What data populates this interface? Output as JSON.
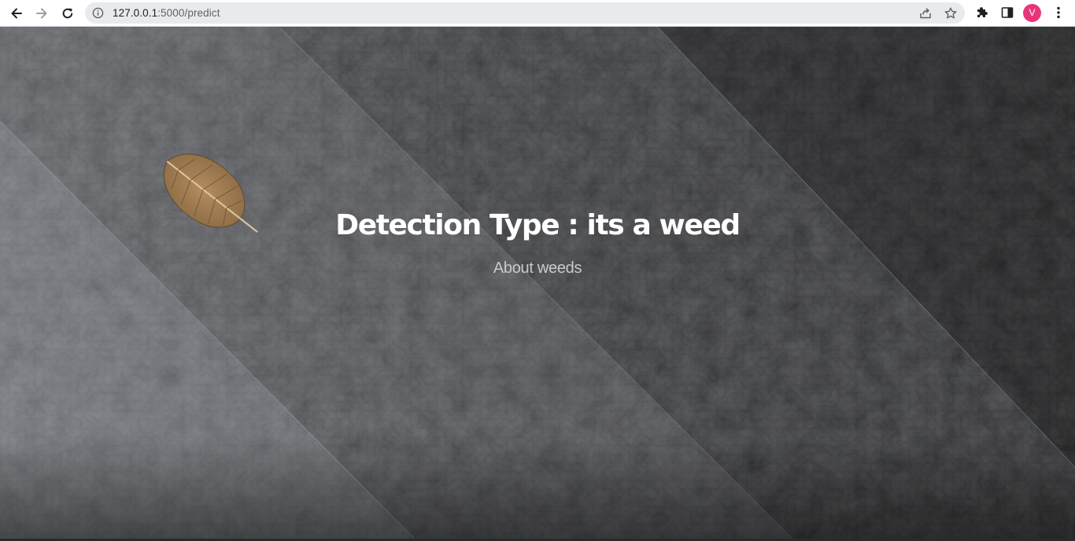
{
  "browser": {
    "url_host": "127.0.0.1",
    "url_path": ":5000/predict",
    "profile_initial": "V",
    "profile_color": "#e8357a",
    "icons": {
      "back": "arrow-left-icon",
      "forward": "arrow-right-icon",
      "reload": "reload-icon",
      "site_info": "info-icon",
      "share": "share-icon",
      "bookmark": "star-icon",
      "extensions": "puzzle-icon",
      "side_panel": "side-panel-icon",
      "menu": "kebab-menu-icon"
    }
  },
  "hero": {
    "title": "Detection Type : its a weed",
    "subtitle": "About weeds",
    "title_color": "#ffffff",
    "subtitle_color": "#c9cacc"
  }
}
